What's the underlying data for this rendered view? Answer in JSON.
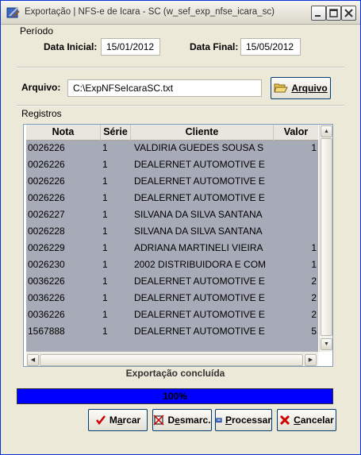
{
  "window": {
    "title": "Exportação  |  NFS-e de Icara - SC (w_sef_exp_nfse_icara_sc)"
  },
  "periodo": {
    "group_label": "Período",
    "data_inicial_label": "Data Inicial:",
    "data_inicial_value": "15/01/2012",
    "data_final_label": "Data Final:",
    "data_final_value": "15/05/2012"
  },
  "arquivo": {
    "label": "Arquivo:",
    "value": "C:\\ExpNFSeIcaraSC.txt",
    "button_label": "Arquivo",
    "button_icon": "folder-open-icon"
  },
  "registros": {
    "group_label": "Registros",
    "columns": [
      "Nota",
      "Série",
      "Cliente",
      "Valor"
    ],
    "rows": [
      [
        "0026226",
        "1",
        "VALDIRIA GUEDES SOUSA S",
        "1"
      ],
      [
        "0026226",
        "1",
        "DEALERNET AUTOMOTIVE E",
        ""
      ],
      [
        "0026226",
        "1",
        "DEALERNET AUTOMOTIVE E",
        ""
      ],
      [
        "0026226",
        "1",
        "DEALERNET AUTOMOTIVE E",
        ""
      ],
      [
        "0026227",
        "1",
        "SILVANA DA SILVA SANTANA",
        ""
      ],
      [
        "0026228",
        "1",
        "SILVANA DA SILVA SANTANA",
        ""
      ],
      [
        "0026229",
        "1",
        "ADRIANA MARTINELI VIEIRA",
        "1"
      ],
      [
        "0026230",
        "1",
        "2002 DISTRIBUIDORA E COM",
        "1"
      ],
      [
        "0036226",
        "1",
        "DEALERNET AUTOMOTIVE E",
        "2"
      ],
      [
        "0036226",
        "1",
        "DEALERNET AUTOMOTIVE E",
        "2"
      ],
      [
        "0036226",
        "1",
        "DEALERNET AUTOMOTIVE E",
        "2"
      ],
      [
        "1567888",
        "1",
        "DEALERNET AUTOMOTIVE E",
        "5"
      ]
    ]
  },
  "status": {
    "text": "Exportação concluída",
    "progress_text": "100%",
    "progress_fraction": 1.0,
    "progress_color": "#0000ff"
  },
  "buttons": {
    "marcar": {
      "pre": "M",
      "u": "a",
      "post": "rcar"
    },
    "desmarcar": {
      "pre": "D",
      "u": "e",
      "post": "smarc."
    },
    "processar": {
      "pre": "",
      "u": "P",
      "post": "rocessar"
    },
    "cancelar": {
      "pre": "",
      "u": "C",
      "post": "ancelar"
    }
  }
}
